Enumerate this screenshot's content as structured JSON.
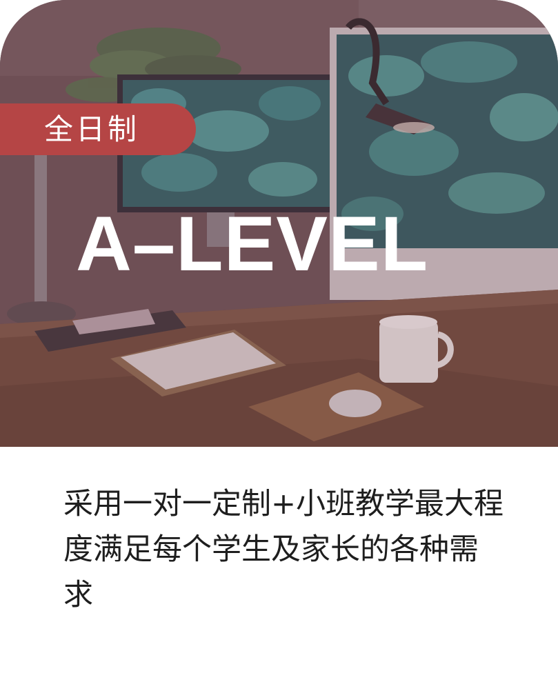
{
  "card": {
    "badge": "全日制",
    "title": "A–LEVEL",
    "description": "采用一对一定制+小班教学最大程度满足每个学生及家长的各种需求",
    "hero_image": "desk-workspace-with-monitors",
    "colors": {
      "badge": "#b54545",
      "overlay": "#6e5358",
      "title": "#ffffff",
      "description": "#1e1e1e"
    }
  }
}
